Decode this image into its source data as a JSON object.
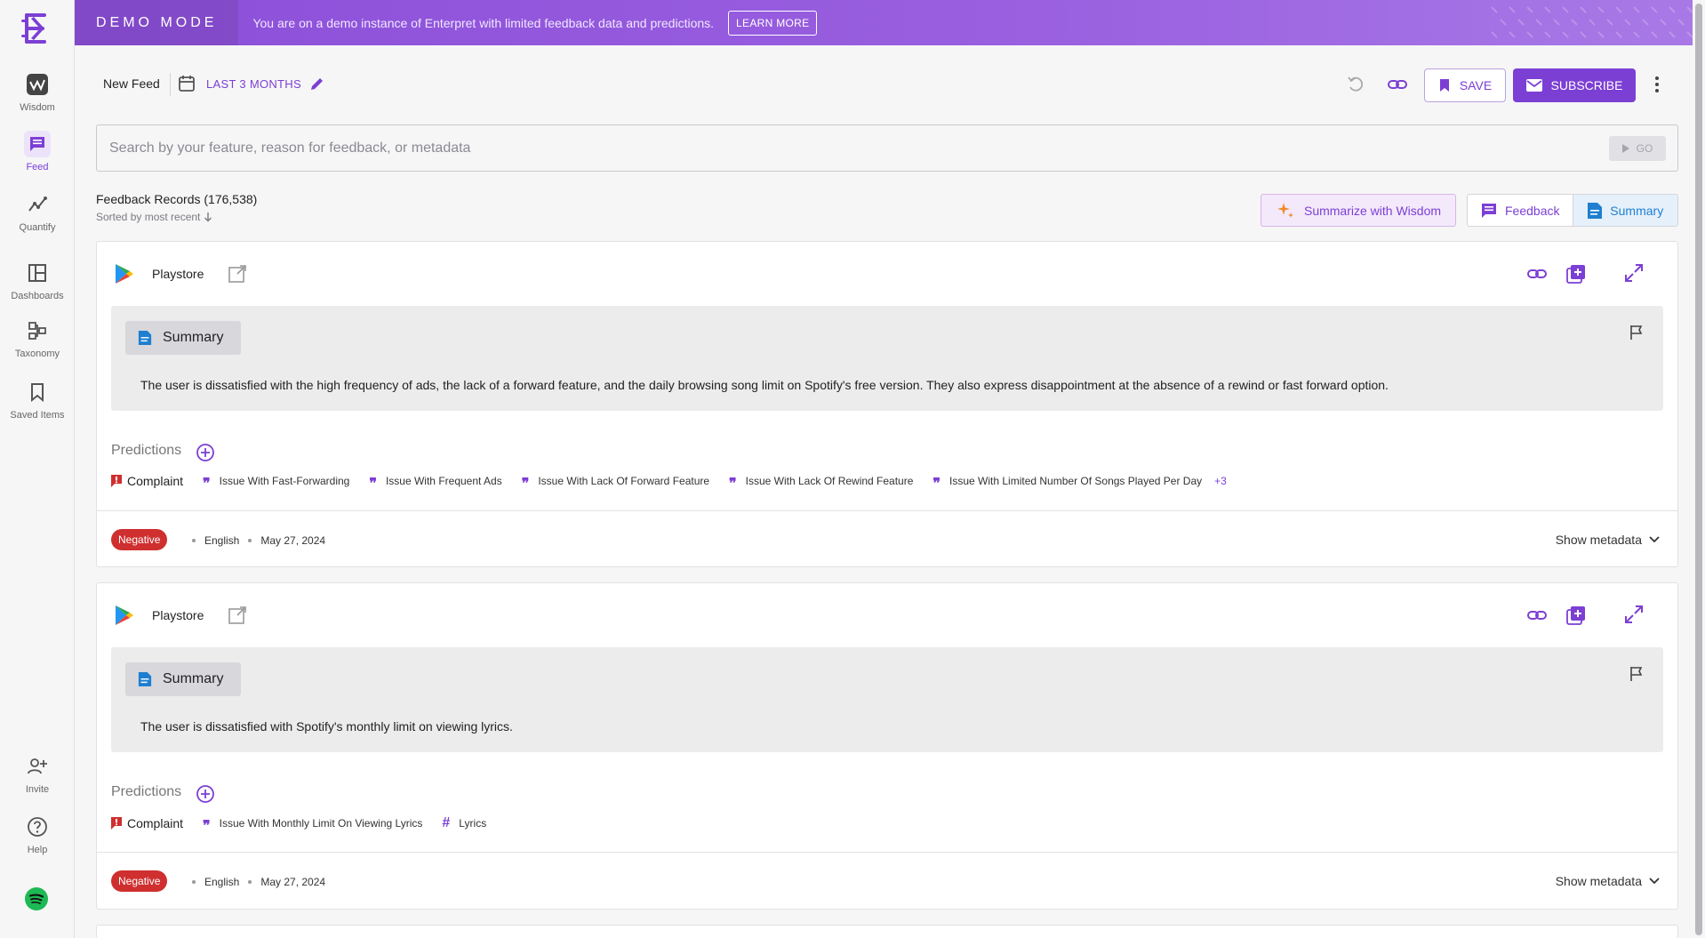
{
  "sidebar": {
    "items": [
      {
        "label": "Wisdom"
      },
      {
        "label": "Feed"
      },
      {
        "label": "Quantify"
      },
      {
        "label": "Dashboards"
      },
      {
        "label": "Taxonomy"
      },
      {
        "label": "Saved Items"
      },
      {
        "label": "Invite"
      },
      {
        "label": "Help"
      }
    ],
    "active": "Feed"
  },
  "banner": {
    "mode": "DEMO MODE",
    "text": "You are on a demo instance of Enterpret with limited feedback data and predictions.",
    "button": "LEARN MORE"
  },
  "toolbar": {
    "feed_name": "New Feed",
    "date_range": "LAST 3 MONTHS",
    "save_label": "SAVE",
    "subscribe_label": "SUBSCRIBE"
  },
  "search": {
    "placeholder": "Search by your feature, reason for feedback, or metadata",
    "go_label": "GO"
  },
  "records": {
    "title": "Feedback Records (176,538)",
    "sorted": "Sorted by most recent",
    "summarize_label": "Summarize with Wisdom",
    "view_feedback": "Feedback",
    "view_summary": "Summary"
  },
  "cards": [
    {
      "source": "Playstore",
      "summary_label": "Summary",
      "summary": "The user is dissatisfied with the high frequency of ads, the lack of a forward feature, and the daily browsing song limit on Spotify's free version. They also express disappointment at the absence of a rewind or fast forward option.",
      "predictions_label": "Predictions",
      "complaint": "Complaint",
      "tags": [
        "Issue With Fast-Forwarding",
        "Issue With Frequent Ads",
        "Issue With Lack Of Forward Feature",
        "Issue With Lack Of Rewind Feature",
        "Issue With Limited Number Of Songs Played Per Day"
      ],
      "more": "+3",
      "sentiment": "Negative",
      "language": "English",
      "date": "May 27, 2024",
      "show_metadata": "Show metadata"
    },
    {
      "source": "Playstore",
      "summary_label": "Summary",
      "summary": "The user is dissatisfied with Spotify's monthly limit on viewing lyrics.",
      "predictions_label": "Predictions",
      "complaint": "Complaint",
      "tags": [
        "Issue With Monthly Limit On Viewing Lyrics"
      ],
      "hash_tag": "Lyrics",
      "sentiment": "Negative",
      "language": "English",
      "date": "May 27, 2024",
      "show_metadata": "Show metadata"
    }
  ],
  "colors": {
    "accent": "#7c3fd4",
    "negative": "#cf2f2f",
    "summary_blue": "#1e7fd0"
  }
}
